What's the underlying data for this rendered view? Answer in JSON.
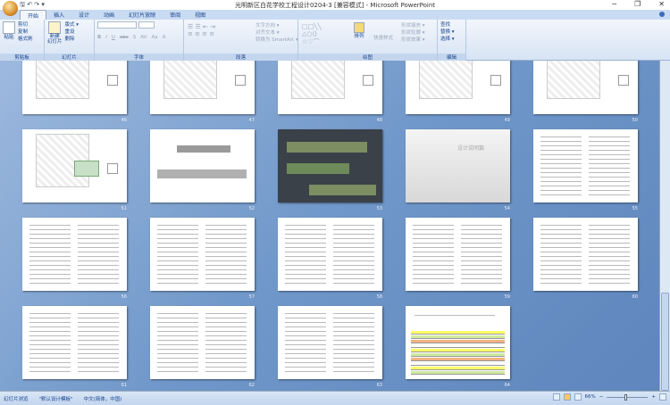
{
  "window": {
    "title": "光明新区白花学校工程设计0204-3 [兼容模式] - Microsoft PowerPoint",
    "qat": "🖫 ↶ ↷ ▾",
    "minimize": "─",
    "restore": "❐",
    "close": "✕"
  },
  "tabs": [
    "开始",
    "插入",
    "设计",
    "动画",
    "幻灯片放映",
    "审阅",
    "视图"
  ],
  "ribbon": {
    "clipboard": {
      "label": "剪贴板",
      "paste": "粘贴",
      "cut": "剪切",
      "copy": "复制",
      "format_painter": "格式刷"
    },
    "slides": {
      "label": "幻灯片",
      "new_slide": "新建\n幻灯片",
      "layout": "版式 ▾",
      "reset": "重设",
      "delete": "删除"
    },
    "font": {
      "label": "字体",
      "font_value": "",
      "size_value": "",
      "bold": "B",
      "italic": "I",
      "underline": "U",
      "strike": "abc",
      "shadow": "S",
      "spacing": "AV",
      "case": "Aa",
      "color": "A"
    },
    "paragraph": {
      "label": "段落",
      "text_direction": "文字方向 ▾",
      "align_text": "对齐文本 ▾",
      "smartart": "转换为 SmartArt ▾"
    },
    "drawing": {
      "label": "绘图",
      "arrange": "排列",
      "quick_styles": "快速样式",
      "shape_fill": "形状填充 ▾",
      "shape_outline": "形状轮廓 ▾",
      "shape_effects": "形状效果 ▾"
    },
    "editing": {
      "label": "编辑",
      "find": "查找",
      "replace": "替换 ▾",
      "select": "选择 ▾"
    }
  },
  "slides": [
    {
      "num": "46",
      "kind": "plan"
    },
    {
      "num": "47",
      "kind": "plan"
    },
    {
      "num": "48",
      "kind": "plan"
    },
    {
      "num": "49",
      "kind": "plan"
    },
    {
      "num": "50",
      "kind": "plan"
    },
    {
      "num": "51",
      "kind": "drawing"
    },
    {
      "num": "52",
      "kind": "elevation"
    },
    {
      "num": "53",
      "kind": "dark"
    },
    {
      "num": "54",
      "kind": "photo",
      "title": "设计说明篇"
    },
    {
      "num": "55",
      "kind": "text"
    },
    {
      "num": "56",
      "kind": "text"
    },
    {
      "num": "57",
      "kind": "text"
    },
    {
      "num": "58",
      "kind": "text"
    },
    {
      "num": "59",
      "kind": "text"
    },
    {
      "num": "60",
      "kind": "text"
    },
    {
      "num": "61",
      "kind": "text"
    },
    {
      "num": "62",
      "kind": "text"
    },
    {
      "num": "63",
      "kind": "text"
    },
    {
      "num": "64",
      "kind": "table"
    }
  ],
  "status": {
    "view": "幻灯片浏览",
    "theme": "\"默认设计模板\"",
    "language": "中文(简体，中国)",
    "zoom": "66%",
    "zoom_percent": 66,
    "zoom_out": "−",
    "zoom_in": "+"
  },
  "colors": {
    "accent": "#15428b",
    "sorter_bg": "#6f97c9",
    "selected_dark": "#3a4148"
  }
}
